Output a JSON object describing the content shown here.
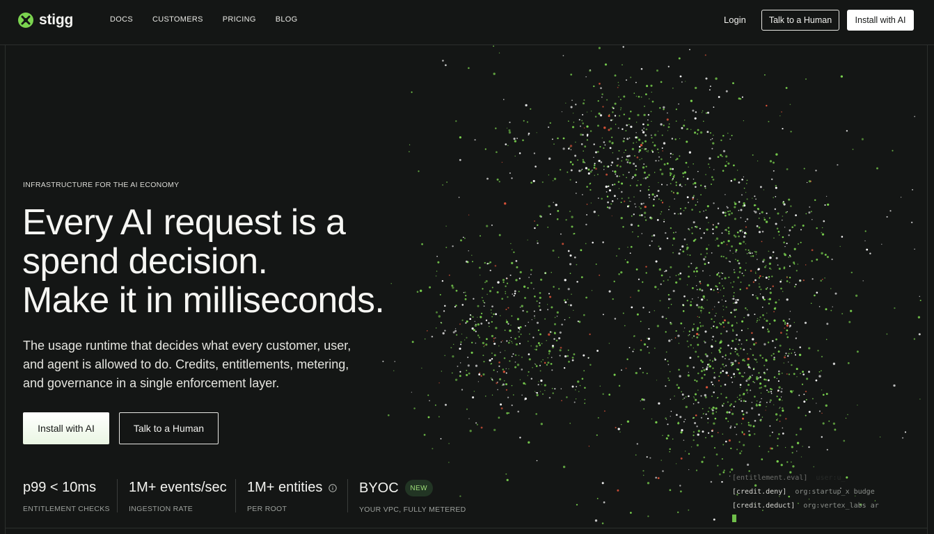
{
  "brand": {
    "name": "stigg",
    "accent": "#7bd44f"
  },
  "nav": {
    "items": [
      "DOCS",
      "CUSTOMERS",
      "PRICING",
      "BLOG"
    ],
    "login": "Login",
    "talk_button": "Talk to a Human",
    "install_button": "Install with AI"
  },
  "hero": {
    "eyebrow": "INFRASTRUCTURE FOR THE AI ECONOMY",
    "headline": [
      "Every AI request is a",
      "spend decision.",
      "Make it in milliseconds."
    ],
    "subtext": [
      "The usage runtime that decides what every customer, user,",
      "and agent is allowed to do. Credits, entitlements, metering,",
      "and governance in a single enforcement layer."
    ],
    "primary_cta": "Install with AI",
    "secondary_cta": "Talk to a Human"
  },
  "stats": [
    {
      "value": "p99 < 10ms",
      "label": "ENTITLEMENT CHECKS"
    },
    {
      "value": "1M+ events/sec",
      "label": "INGESTION RATE"
    },
    {
      "value": "1M+ entities",
      "label": "PER ROOT",
      "icon": "info-icon"
    },
    {
      "value": "BYOC",
      "label": "YOUR VPC, FULLY METERED",
      "badge": "NEW"
    }
  ],
  "terminal": {
    "lines": [
      {
        "event": "[entitlement.eval]",
        "detail": "user:u_"
      },
      {
        "event": "[credit.deny]",
        "detail": "org:startup_x  budge"
      },
      {
        "event": "[credit.deduct]",
        "detail": "org:vertex_labs  ar"
      }
    ]
  },
  "particles": {
    "colors": {
      "green": "#7bd44f",
      "white": "#ffffff",
      "red": "#e2553a"
    }
  }
}
